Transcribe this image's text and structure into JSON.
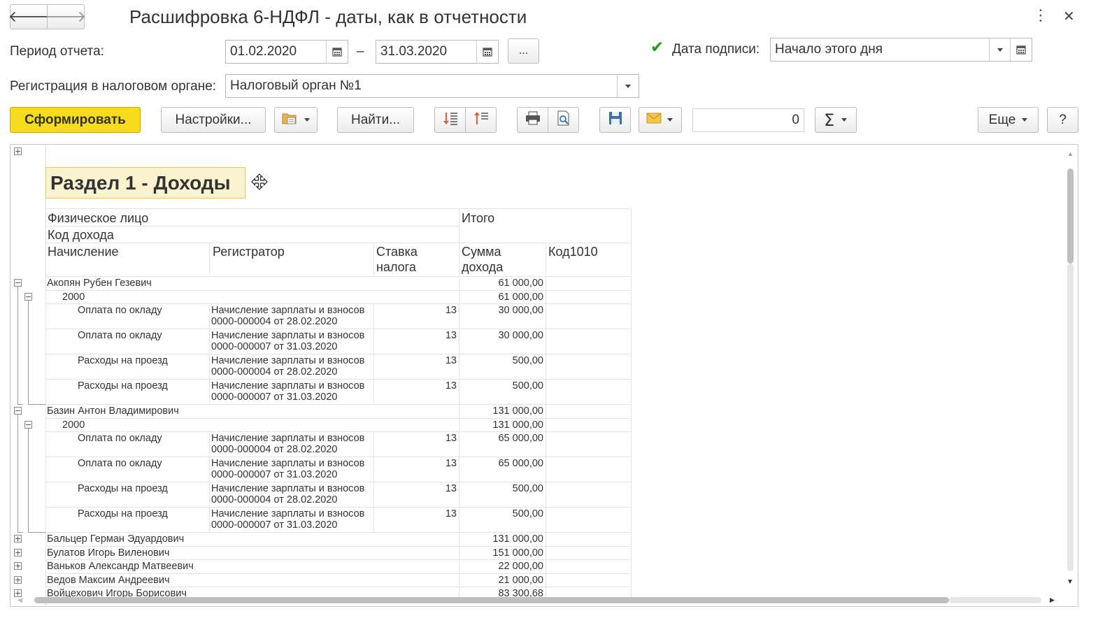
{
  "window": {
    "title": "Расшифровка 6-НДФЛ - даты, как в отчетности",
    "back_glyph": "🡐",
    "forward_glyph": "🡒",
    "more_glyph": "⋮",
    "close_glyph": "✕"
  },
  "filters": {
    "period_label": "Период отчета:",
    "date_from": "01.02.2020",
    "dash": "–",
    "date_to": "31.03.2020",
    "period_button": "...",
    "sign_date_checked": true,
    "sign_date_check_glyph": "✔",
    "sign_date_label": "Дата подписи:",
    "sign_date_value": "Начало этого дня",
    "registration_label": "Регистрация в налоговом органе:",
    "registration_value": "Налоговый орган №1"
  },
  "toolbar": {
    "generate_label": "Сформировать",
    "settings_label": "Настройки...",
    "find_label": "Найти...",
    "sum_value": "0",
    "sigma_glyph": "Σ",
    "more_label": "Еще",
    "help_label": "?"
  },
  "report": {
    "section_title": "Раздел 1 - Доходы",
    "headers": {
      "person": "Физическое лицо",
      "code": "Код дохода",
      "accrual": "Начисление",
      "registrar": "Регистратор",
      "rate": "Ставка налога",
      "total": "Итого",
      "amount": "Сумма дохода",
      "code1010": "Код1010"
    },
    "rows": [
      {
        "level": 0,
        "expanded": true,
        "text": "Акопян Рубен Гезевич",
        "amount": "61 000,00"
      },
      {
        "level": 1,
        "expanded": true,
        "text": "2000",
        "amount": "61 000,00"
      },
      {
        "level": 2,
        "text": "Оплата по окладу",
        "registrar": "Начисление зарплаты и взносов 0000-000004 от 28.02.2020",
        "rate": "13",
        "amount": "30 000,00"
      },
      {
        "level": 2,
        "text": "Оплата по окладу",
        "registrar": "Начисление зарплаты и взносов 0000-000007 от 31.03.2020",
        "rate": "13",
        "amount": "30 000,00"
      },
      {
        "level": 2,
        "text": "Расходы на проезд",
        "registrar": "Начисление зарплаты и взносов 0000-000004 от 28.02.2020",
        "rate": "13",
        "amount": "500,00"
      },
      {
        "level": 2,
        "text": "Расходы на проезд",
        "registrar": "Начисление зарплаты и взносов 0000-000007 от 31.03.2020",
        "rate": "13",
        "amount": "500,00"
      },
      {
        "level": 0,
        "expanded": true,
        "text": "Базин Антон Владимирович",
        "amount": "131 000,00"
      },
      {
        "level": 1,
        "expanded": true,
        "text": "2000",
        "amount": "131 000,00"
      },
      {
        "level": 2,
        "text": "Оплата по окладу",
        "registrar": "Начисление зарплаты и взносов 0000-000004 от 28.02.2020",
        "rate": "13",
        "amount": "65 000,00"
      },
      {
        "level": 2,
        "text": "Оплата по окладу",
        "registrar": "Начисление зарплаты и взносов 0000-000007 от 31.03.2020",
        "rate": "13",
        "amount": "65 000,00"
      },
      {
        "level": 2,
        "text": "Расходы на проезд",
        "registrar": "Начисление зарплаты и взносов 0000-000004 от 28.02.2020",
        "rate": "13",
        "amount": "500,00"
      },
      {
        "level": 2,
        "text": "Расходы на проезд",
        "registrar": "Начисление зарплаты и взносов 0000-000007 от 31.03.2020",
        "rate": "13",
        "amount": "500,00"
      },
      {
        "level": 0,
        "expanded": false,
        "text": "Бальцер Герман Эдуардович",
        "amount": "131 000,00"
      },
      {
        "level": 0,
        "expanded": false,
        "text": "Булатов Игорь Виленович",
        "amount": "151 000,00"
      },
      {
        "level": 0,
        "expanded": false,
        "text": "Ваньков Александр Матвеевич",
        "amount": "22 000,00"
      },
      {
        "level": 0,
        "expanded": false,
        "text": "Ведов Максим Андреевич",
        "amount": "21 000,00"
      },
      {
        "level": 0,
        "expanded": false,
        "text": "Войцехович Игорь Борисович",
        "amount": "83 300,68"
      }
    ]
  },
  "colors": {
    "generate_bg": "#f7dc1d",
    "generate_border": "#c9a900",
    "section_bg": "#fbf2d0",
    "section_border": "#f2c84a",
    "checkbox_green": "#1a9c1a"
  }
}
